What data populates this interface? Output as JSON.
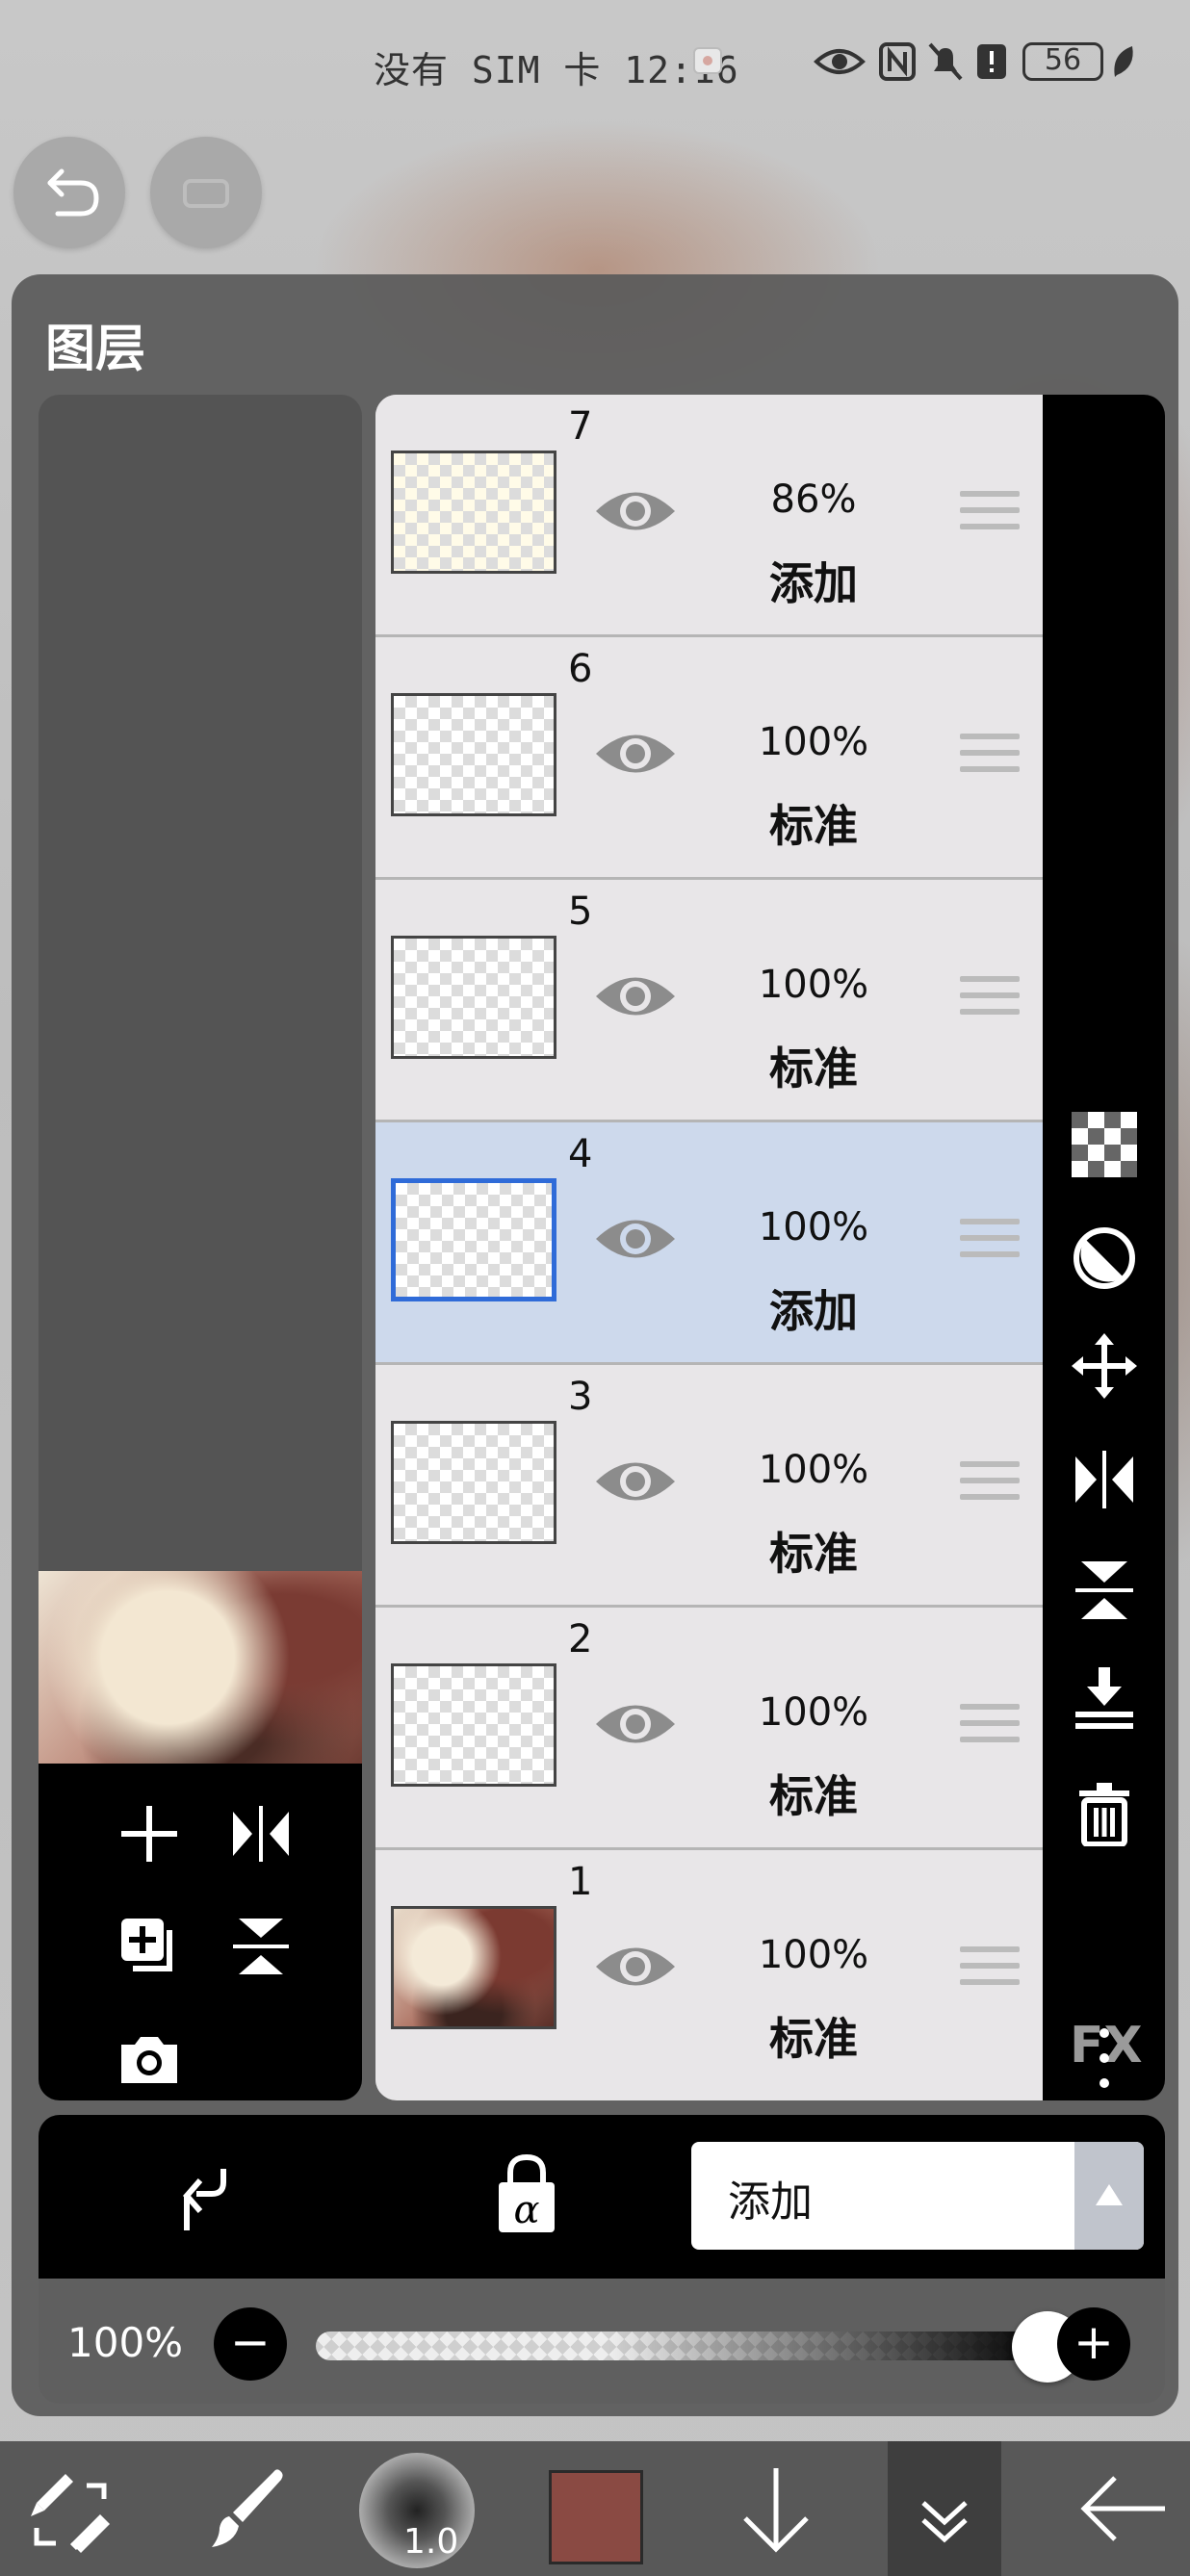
{
  "status_bar": {
    "carrier_time": "没有 SIM 卡 12:16",
    "battery": "56"
  },
  "panel": {
    "title": "图层"
  },
  "layers": [
    {
      "number": "7",
      "opacity": "86%",
      "mode": "添加",
      "selected": false
    },
    {
      "number": "6",
      "opacity": "100%",
      "mode": "标准",
      "selected": false
    },
    {
      "number": "5",
      "opacity": "100%",
      "mode": "标准",
      "selected": false
    },
    {
      "number": "4",
      "opacity": "100%",
      "mode": "添加",
      "selected": true
    },
    {
      "number": "3",
      "opacity": "100%",
      "mode": "标准",
      "selected": false
    },
    {
      "number": "2",
      "opacity": "100%",
      "mode": "标准",
      "selected": false
    },
    {
      "number": "1",
      "opacity": "100%",
      "mode": "标准",
      "selected": false
    }
  ],
  "right_toolbar": {
    "fx_label": "FX",
    "icons": [
      "transparency-checker-icon",
      "contrast-icon",
      "move-icon",
      "flip-horizontal-icon",
      "flip-vertical-icon",
      "merge-down-icon",
      "trash-icon",
      "fx-icon",
      "more-icon"
    ]
  },
  "preview_tools": [
    "add-layer-icon",
    "flip-layer-horizontal-icon",
    "duplicate-layer-icon",
    "flip-layer-vertical-icon",
    "camera-icon"
  ],
  "blend": {
    "current_mode": "添加"
  },
  "opacity": {
    "label": "100%",
    "value": 1.0
  },
  "bottom_toolbar": {
    "brush_size": "1.0",
    "color": "#8a4a43"
  },
  "colors": {
    "selected_row": "#cdd9ec",
    "selected_border": "#2f6bd8",
    "panel_bg": "#5a5a5a"
  }
}
